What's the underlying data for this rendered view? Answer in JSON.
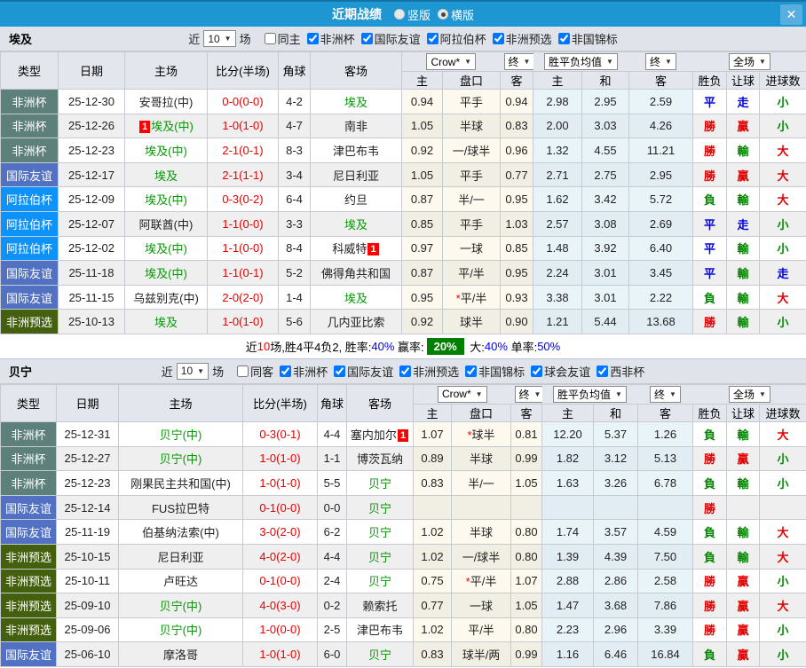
{
  "title_bar": {
    "title": "近期战绩",
    "vertical_label": "竖版",
    "horizontal_label": "横版",
    "selected_layout": "横版",
    "close": "✕"
  },
  "columns": {
    "type": "类型",
    "date": "日期",
    "home": "主场",
    "score": "比分(半场)",
    "corner": "角球",
    "away": "客场",
    "odds_home": "主",
    "odds_line": "盘口",
    "odds_away": "客",
    "mean_home": "主",
    "mean_draw": "和",
    "mean_away": "客",
    "result_wdl": "胜负",
    "result_handicap": "让球",
    "result_goals": "进球数"
  },
  "dropdowns": {
    "bookmaker": "Crow*",
    "final": "终",
    "mean": "胜平负均值",
    "scope": "全场"
  },
  "type_colors": {
    "非洲杯": "#5d807b",
    "国际友谊": "#5271c2",
    "阿拉伯杯": "#0d92fa",
    "非洲预选": "#44600e"
  },
  "accent_colors": {
    "titlebar_blue": "#1e96d2",
    "score_red": "#e60000",
    "focal_green": "#009900",
    "win_red": "#e60000",
    "lose_green": "#008800",
    "draw_blue": "#0000dd",
    "summary_box_green": "#008000"
  },
  "sections": [
    {
      "team": "埃及",
      "filter": {
        "near": "近",
        "games": "10",
        "suffix": "场",
        "same": "同主",
        "same_checked": false,
        "leagues": [
          "非洲杯",
          "国际友谊",
          "阿拉伯杯",
          "非洲预选",
          "非国锦标"
        ]
      },
      "rows": [
        {
          "type": "非洲杯",
          "date": "25-12-30",
          "home": "安哥拉(中)",
          "home_focal": false,
          "home_badge": null,
          "score": "0-0(0-0)",
          "corner": "4-2",
          "away": "埃及",
          "away_focal": true,
          "away_badge": null,
          "odds": [
            "0.94",
            "平手",
            "0.94"
          ],
          "mean": [
            "2.98",
            "2.95",
            "2.59"
          ],
          "result": [
            "平",
            "走",
            "小"
          ]
        },
        {
          "type": "非洲杯",
          "date": "25-12-26",
          "home": "埃及(中)",
          "home_focal": true,
          "home_badge": {
            "text": "1",
            "pos": "before"
          },
          "score": "1-0(1-0)",
          "corner": "4-7",
          "away": "南非",
          "away_focal": false,
          "away_badge": null,
          "odds": [
            "1.05",
            "半球",
            "0.83"
          ],
          "mean": [
            "2.00",
            "3.03",
            "4.26"
          ],
          "result": [
            "勝",
            "贏",
            "小"
          ]
        },
        {
          "type": "非洲杯",
          "date": "25-12-23",
          "home": "埃及(中)",
          "home_focal": true,
          "home_badge": null,
          "score": "2-1(0-1)",
          "corner": "8-3",
          "away": "津巴布韦",
          "away_focal": false,
          "away_badge": null,
          "odds": [
            "0.92",
            "一/球半",
            "0.96"
          ],
          "mean": [
            "1.32",
            "4.55",
            "11.21"
          ],
          "result": [
            "勝",
            "輸",
            "大"
          ]
        },
        {
          "type": "国际友谊",
          "date": "25-12-17",
          "home": "埃及",
          "home_focal": true,
          "home_badge": null,
          "score": "2-1(1-1)",
          "corner": "3-4",
          "away": "尼日利亚",
          "away_focal": false,
          "away_badge": null,
          "odds": [
            "1.05",
            "平手",
            "0.77"
          ],
          "mean": [
            "2.71",
            "2.75",
            "2.95"
          ],
          "result": [
            "勝",
            "贏",
            "大"
          ]
        },
        {
          "type": "阿拉伯杯",
          "date": "25-12-09",
          "home": "埃及(中)",
          "home_focal": true,
          "home_badge": null,
          "score": "0-3(0-2)",
          "corner": "6-4",
          "away": "约旦",
          "away_focal": false,
          "away_badge": null,
          "odds": [
            "0.87",
            "半/一",
            "0.95"
          ],
          "mean": [
            "1.62",
            "3.42",
            "5.72"
          ],
          "result": [
            "負",
            "輸",
            "大"
          ]
        },
        {
          "type": "阿拉伯杯",
          "date": "25-12-07",
          "home": "阿联酋(中)",
          "home_focal": false,
          "home_badge": null,
          "score": "1-1(0-0)",
          "corner": "3-3",
          "away": "埃及",
          "away_focal": true,
          "away_badge": null,
          "odds": [
            "0.85",
            "平手",
            "1.03"
          ],
          "mean": [
            "2.57",
            "3.08",
            "2.69"
          ],
          "result": [
            "平",
            "走",
            "小"
          ]
        },
        {
          "type": "阿拉伯杯",
          "date": "25-12-02",
          "home": "埃及(中)",
          "home_focal": true,
          "home_badge": null,
          "score": "1-1(0-0)",
          "corner": "8-4",
          "away": "科威特",
          "away_focal": false,
          "away_badge": {
            "text": "1",
            "pos": "after"
          },
          "odds": [
            "0.97",
            "一球",
            "0.85"
          ],
          "mean": [
            "1.48",
            "3.92",
            "6.40"
          ],
          "result": [
            "平",
            "輸",
            "小"
          ]
        },
        {
          "type": "国际友谊",
          "date": "25-11-18",
          "home": "埃及(中)",
          "home_focal": true,
          "home_badge": null,
          "score": "1-1(0-1)",
          "corner": "5-2",
          "away": "佛得角共和国",
          "away_focal": false,
          "away_badge": null,
          "odds": [
            "0.87",
            "平/半",
            "0.95"
          ],
          "mean": [
            "2.24",
            "3.01",
            "3.45"
          ],
          "result": [
            "平",
            "輸",
            "走"
          ]
        },
        {
          "type": "国际友谊",
          "date": "25-11-15",
          "home": "乌兹别克(中)",
          "home_focal": false,
          "home_badge": null,
          "score": "2-0(2-0)",
          "corner": "1-4",
          "away": "埃及",
          "away_focal": true,
          "away_badge": null,
          "odds": [
            "0.95",
            "*平/半",
            "0.93"
          ],
          "mean": [
            "3.38",
            "3.01",
            "2.22"
          ],
          "result": [
            "負",
            "輸",
            "大"
          ]
        },
        {
          "type": "非洲预选",
          "date": "25-10-13",
          "home": "埃及",
          "home_focal": true,
          "home_badge": null,
          "score": "1-0(1-0)",
          "corner": "5-6",
          "away": "几内亚比索",
          "away_focal": false,
          "away_badge": null,
          "odds": [
            "0.92",
            "球半",
            "0.90"
          ],
          "mean": [
            "1.21",
            "5.44",
            "13.68"
          ],
          "result": [
            "勝",
            "輸",
            "小"
          ]
        }
      ],
      "summary": [
        {
          "text": "近",
          "color": "black"
        },
        {
          "text": "10",
          "color": "red"
        },
        {
          "text": "场,胜4平4负2, 胜率:",
          "color": "black"
        },
        {
          "text": "40%",
          "color": "blue"
        },
        {
          "text": " 赢率:",
          "color": "black"
        },
        {
          "text": "20%",
          "color": "green-box"
        },
        {
          "text": " 大:",
          "color": "black"
        },
        {
          "text": "40%",
          "color": "blue"
        },
        {
          "text": " 单率:",
          "color": "black"
        },
        {
          "text": "50%",
          "color": "blue"
        }
      ]
    },
    {
      "team": "贝宁",
      "filter": {
        "near": "近",
        "games": "10",
        "suffix": "场",
        "same": "同客",
        "same_checked": false,
        "leagues": [
          "非洲杯",
          "国际友谊",
          "非洲预选",
          "非国锦标",
          "球会友谊",
          "西非杯"
        ]
      },
      "rows": [
        {
          "type": "非洲杯",
          "date": "25-12-31",
          "home": "贝宁(中)",
          "home_focal": true,
          "home_badge": null,
          "score": "0-3(0-1)",
          "corner": "4-4",
          "away": "塞内加尔",
          "away_focal": false,
          "away_badge": {
            "text": "1",
            "pos": "after"
          },
          "odds": [
            "1.07",
            "*球半",
            "0.81"
          ],
          "mean": [
            "12.20",
            "5.37",
            "1.26"
          ],
          "result": [
            "負",
            "輸",
            "大"
          ]
        },
        {
          "type": "非洲杯",
          "date": "25-12-27",
          "home": "贝宁(中)",
          "home_focal": true,
          "home_badge": null,
          "score": "1-0(1-0)",
          "corner": "1-1",
          "away": "博茨瓦纳",
          "away_focal": false,
          "away_badge": null,
          "odds": [
            "0.89",
            "半球",
            "0.99"
          ],
          "mean": [
            "1.82",
            "3.12",
            "5.13"
          ],
          "result": [
            "勝",
            "贏",
            "小"
          ]
        },
        {
          "type": "非洲杯",
          "date": "25-12-23",
          "home": "刚果民主共和国(中)",
          "home_focal": false,
          "home_badge": null,
          "score": "1-0(1-0)",
          "corner": "5-5",
          "away": "贝宁",
          "away_focal": true,
          "away_badge": null,
          "odds": [
            "0.83",
            "半/一",
            "1.05"
          ],
          "mean": [
            "1.63",
            "3.26",
            "6.78"
          ],
          "result": [
            "負",
            "輸",
            "小"
          ]
        },
        {
          "type": "国际友谊",
          "date": "25-12-14",
          "home": "FUS拉巴特",
          "home_focal": false,
          "home_badge": null,
          "score": "0-1(0-0)",
          "corner": "0-0",
          "away": "贝宁",
          "away_focal": true,
          "away_badge": null,
          "odds": [
            "",
            "",
            ""
          ],
          "mean": [
            "",
            "",
            ""
          ],
          "result": [
            "勝",
            "",
            ""
          ]
        },
        {
          "type": "国际友谊",
          "date": "25-11-19",
          "home": "伯基纳法索(中)",
          "home_focal": false,
          "home_badge": null,
          "score": "3-0(2-0)",
          "corner": "6-2",
          "away": "贝宁",
          "away_focal": true,
          "away_badge": null,
          "odds": [
            "1.02",
            "半球",
            "0.80"
          ],
          "mean": [
            "1.74",
            "3.57",
            "4.59"
          ],
          "result": [
            "負",
            "輸",
            "大"
          ]
        },
        {
          "type": "非洲预选",
          "date": "25-10-15",
          "home": "尼日利亚",
          "home_focal": false,
          "home_badge": null,
          "score": "4-0(2-0)",
          "corner": "4-4",
          "away": "贝宁",
          "away_focal": true,
          "away_badge": null,
          "odds": [
            "1.02",
            "一/球半",
            "0.80"
          ],
          "mean": [
            "1.39",
            "4.39",
            "7.50"
          ],
          "result": [
            "負",
            "輸",
            "大"
          ]
        },
        {
          "type": "非洲预选",
          "date": "25-10-11",
          "home": "卢旺达",
          "home_focal": false,
          "home_badge": null,
          "score": "0-1(0-0)",
          "corner": "2-4",
          "away": "贝宁",
          "away_focal": true,
          "away_badge": null,
          "odds": [
            "0.75",
            "*平/半",
            "1.07"
          ],
          "mean": [
            "2.88",
            "2.86",
            "2.58"
          ],
          "result": [
            "勝",
            "贏",
            "小"
          ]
        },
        {
          "type": "非洲预选",
          "date": "25-09-10",
          "home": "贝宁(中)",
          "home_focal": true,
          "home_badge": null,
          "score": "4-0(3-0)",
          "corner": "0-2",
          "away": "赖索托",
          "away_focal": false,
          "away_badge": null,
          "odds": [
            "0.77",
            "一球",
            "1.05"
          ],
          "mean": [
            "1.47",
            "3.68",
            "7.86"
          ],
          "result": [
            "勝",
            "贏",
            "大"
          ]
        },
        {
          "type": "非洲预选",
          "date": "25-09-06",
          "home": "贝宁(中)",
          "home_focal": true,
          "home_badge": null,
          "score": "1-0(0-0)",
          "corner": "2-5",
          "away": "津巴布韦",
          "away_focal": false,
          "away_badge": null,
          "odds": [
            "1.02",
            "平/半",
            "0.80"
          ],
          "mean": [
            "2.23",
            "2.96",
            "3.39"
          ],
          "result": [
            "勝",
            "贏",
            "小"
          ]
        },
        {
          "type": "国际友谊",
          "date": "25-06-10",
          "home": "摩洛哥",
          "home_focal": false,
          "home_badge": null,
          "score": "1-0(1-0)",
          "corner": "6-0",
          "away": "贝宁",
          "away_focal": true,
          "away_badge": null,
          "odds": [
            "0.83",
            "球半/两",
            "0.99"
          ],
          "mean": [
            "1.16",
            "6.46",
            "16.84"
          ],
          "result": [
            "負",
            "贏",
            "小"
          ]
        }
      ],
      "summary": null
    }
  ]
}
